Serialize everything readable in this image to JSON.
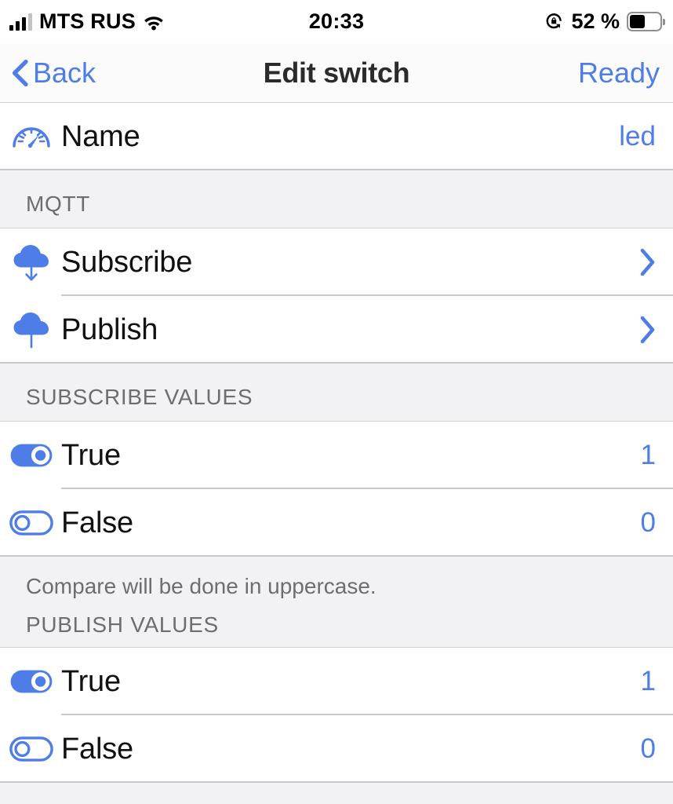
{
  "status_bar": {
    "carrier": "MTS RUS",
    "time": "20:33",
    "battery_percent": "52 %",
    "signal_bars_active": 3,
    "signal_bars_total": 4,
    "wifi_icon": "wifi-icon",
    "rotation_lock_icon": "rotation-lock-icon",
    "battery_icon": "battery-icon",
    "battery_level": 52
  },
  "nav_bar": {
    "back_label": "Back",
    "back_icon": "chevron-left-icon",
    "title": "Edit switch",
    "right_label": "Ready"
  },
  "colors": {
    "accent_blue": "#4f7de8",
    "group_background": "#f2f2f4",
    "row_background": "#ffffff",
    "separator": "#c9c9cb",
    "label_text": "#111111",
    "secondary_text": "#6d6d72"
  },
  "sections": [
    {
      "header": "",
      "footer": "",
      "rows": [
        {
          "name": "name-row",
          "icon": "gauge-icon",
          "label": "Name",
          "value": "led",
          "accessory": "value"
        }
      ]
    },
    {
      "header": "MQTT",
      "footer": "",
      "rows": [
        {
          "name": "subscribe-row",
          "icon": "cloud-download-icon",
          "label": "Subscribe",
          "value": "",
          "accessory": "disclosure"
        },
        {
          "name": "publish-row",
          "icon": "cloud-upload-icon",
          "label": "Publish",
          "value": "",
          "accessory": "disclosure"
        }
      ]
    },
    {
      "header": "SUBSCRIBE VALUES",
      "footer": "Compare will be done in uppercase.",
      "rows": [
        {
          "name": "subscribe-true-row",
          "icon": "toggle-on-icon",
          "label": "True",
          "value": "1",
          "accessory": "value"
        },
        {
          "name": "subscribe-false-row",
          "icon": "toggle-off-icon",
          "label": "False",
          "value": "0",
          "accessory": "value"
        }
      ]
    },
    {
      "header": "PUBLISH VALUES",
      "footer": "",
      "rows": [
        {
          "name": "publish-true-row",
          "icon": "toggle-on-icon",
          "label": "True",
          "value": "1",
          "accessory": "value"
        },
        {
          "name": "publish-false-row",
          "icon": "toggle-off-icon",
          "label": "False",
          "value": "0",
          "accessory": "value"
        }
      ]
    }
  ]
}
